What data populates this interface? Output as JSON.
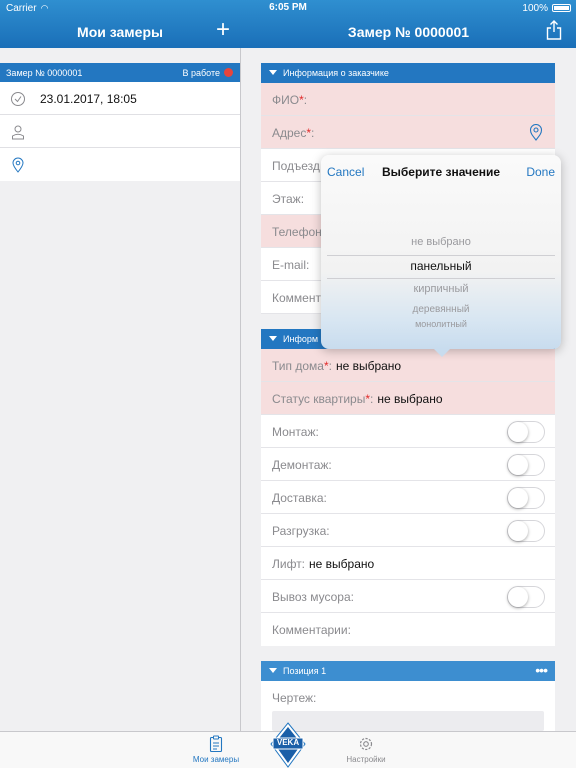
{
  "status_bar": {
    "carrier": "Carrier",
    "time": "6:05 PM",
    "battery": "100%"
  },
  "left_nav": {
    "title": "Мои замеры"
  },
  "right_nav": {
    "title": "Замер № 0000001"
  },
  "measurement_card": {
    "number": "Замер № 0000001",
    "status": "В работе",
    "status_color": "#e8453c",
    "rows": [
      {
        "icon": "clock-icon",
        "text": "23.01.2017, 18:05"
      },
      {
        "icon": "person-icon",
        "text": ""
      },
      {
        "icon": "location-pin-icon",
        "text": ""
      }
    ]
  },
  "customer_section": {
    "title": "Информация о заказчике",
    "fields": {
      "fio": "ФИО",
      "address": "Адрес",
      "entrance": "Подъезд",
      "floor": "Этаж:",
      "phone": "Телефон",
      "email": "E-mail:",
      "comment": "Коммент"
    }
  },
  "object_section": {
    "title": "Информ",
    "house_type": {
      "label": "Тип дома",
      "value": "не выбрано"
    },
    "apartment_status": {
      "label": "Статус квартиры",
      "value": "не выбрано"
    },
    "mounting": "Монтаж:",
    "dismantling": "Демонтаж:",
    "delivery": "Доставка:",
    "unloading": "Разгрузка:",
    "lift": {
      "label": "Лифт:",
      "value": "не выбрано"
    },
    "garbage": "Вывоз мусора:",
    "comments": "Комментарии:"
  },
  "position_section": {
    "title": "Позиция 1",
    "drawing": "Чертеж:"
  },
  "picker": {
    "cancel": "Cancel",
    "title": "Выберите значение",
    "done": "Done",
    "options": [
      "не выбрано",
      "панельный",
      "кирпичный",
      "деревянный",
      "монолитный"
    ],
    "selected": "панельный"
  },
  "tabbar": {
    "measurements": "Мои замеры",
    "settings": "Настройки",
    "logo": "VEKA"
  },
  "colors": {
    "accent": "#2377c1",
    "required_bg": "#f6dede"
  }
}
